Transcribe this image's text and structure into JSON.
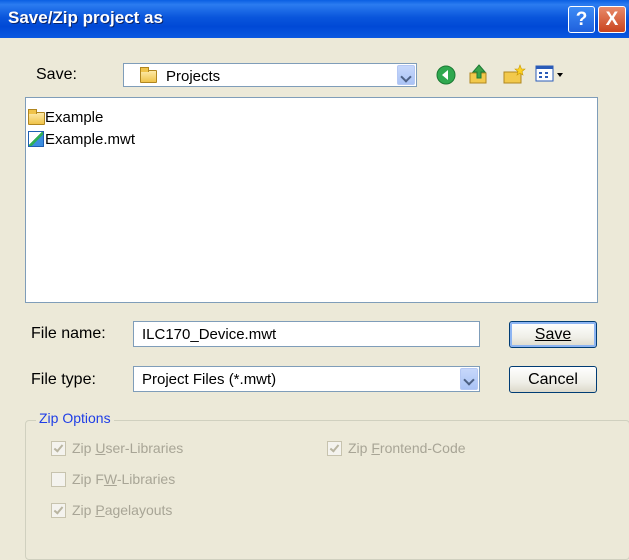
{
  "window": {
    "title": "Save/Zip project as",
    "help_glyph": "?",
    "close_glyph": "X"
  },
  "save_in": {
    "label": "Save:",
    "value": "Projects",
    "toolbar_icons": [
      "back-icon",
      "up-folder-icon",
      "new-folder-icon",
      "view-menu-icon"
    ]
  },
  "files": [
    {
      "name": "Example",
      "icon": "folder-icon"
    },
    {
      "name": "Example.mwt",
      "icon": "mwt-file-icon"
    }
  ],
  "file_name": {
    "label": "File name:",
    "value": "ILC170_Device.mwt"
  },
  "file_type": {
    "label": "File type:",
    "value": "Project Files (*.mwt)"
  },
  "buttons": {
    "save": "Save",
    "cancel": "Cancel"
  },
  "zip_options": {
    "title": "Zip Options",
    "user_libraries": {
      "prefix": "Zip ",
      "accel": "U",
      "rest": "ser-Libraries",
      "checked": true
    },
    "fw_libraries": {
      "prefix": "Zip F",
      "accel": "W",
      "rest": "-Libraries",
      "checked": false
    },
    "pagelayouts": {
      "prefix": "Zip ",
      "accel": "P",
      "rest": "agelayouts",
      "checked": true
    },
    "frontend_code": {
      "prefix": "Zip ",
      "accel": "F",
      "rest": "rontend-Code",
      "checked": true
    }
  }
}
